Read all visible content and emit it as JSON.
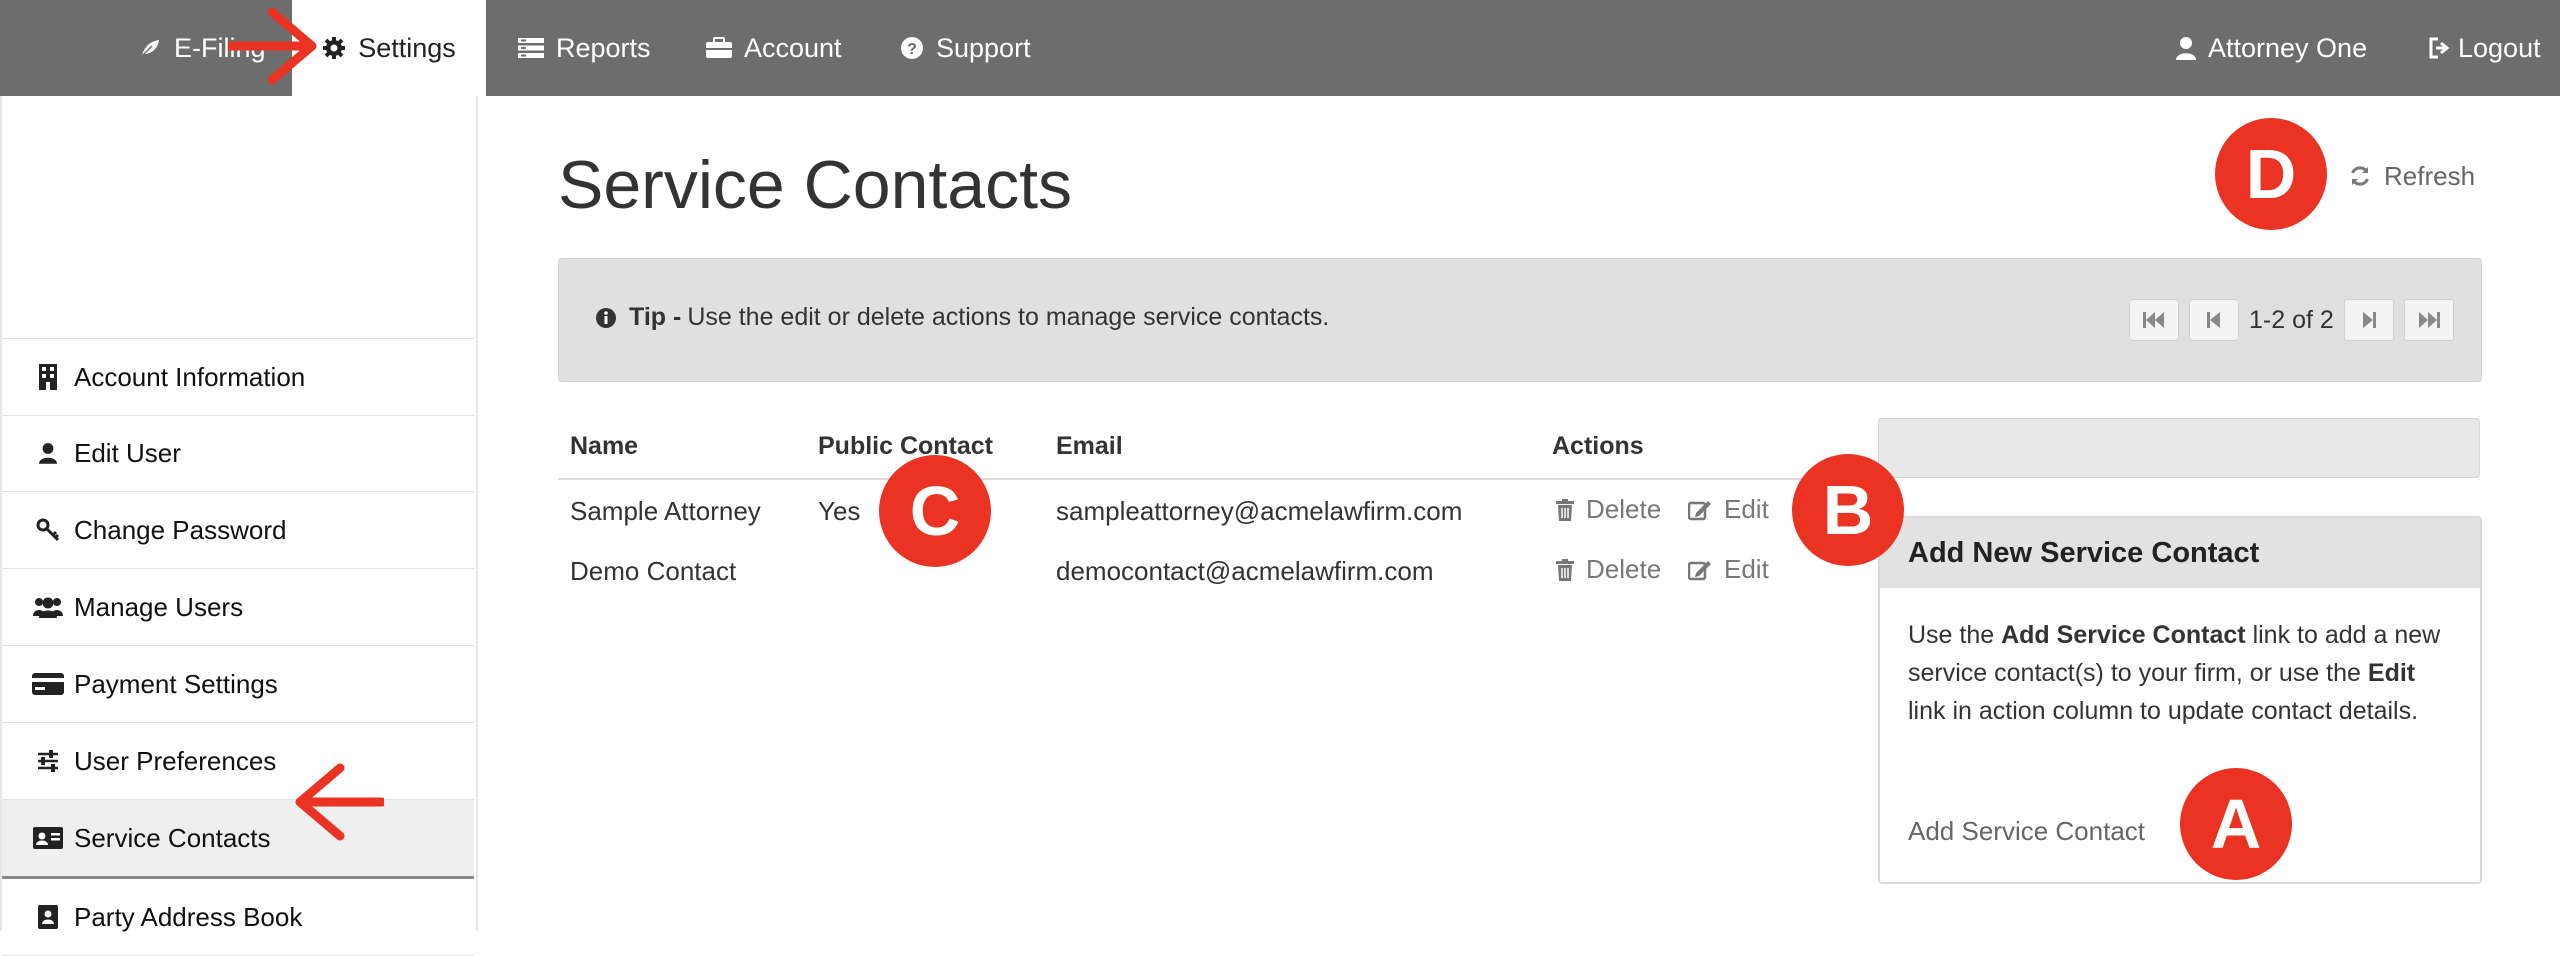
{
  "nav": {
    "efiling": "E-Filing",
    "settings": "Settings",
    "reports": "Reports",
    "account": "Account",
    "support": "Support",
    "user": "Attorney One",
    "logout": "Logout"
  },
  "sidebar": {
    "items": [
      {
        "label": "Account Information",
        "icon": "building-icon"
      },
      {
        "label": "Edit User",
        "icon": "user-icon"
      },
      {
        "label": "Change Password",
        "icon": "key-icon"
      },
      {
        "label": "Manage Users",
        "icon": "users-icon"
      },
      {
        "label": "Payment Settings",
        "icon": "credit-card-icon"
      },
      {
        "label": "User Preferences",
        "icon": "sliders-icon"
      },
      {
        "label": "Service Contacts",
        "icon": "id-card-icon",
        "active": true
      },
      {
        "label": "Party Address Book",
        "icon": "address-book-icon"
      }
    ]
  },
  "page": {
    "title": "Service Contacts",
    "refresh": "Refresh"
  },
  "tip": {
    "label": "Tip -",
    "text": "Use the edit or delete actions to manage service contacts.",
    "page_info": "1-2 of 2"
  },
  "table": {
    "headers": {
      "name": "Name",
      "public": "Public Contact",
      "email": "Email",
      "actions": "Actions"
    },
    "rows": [
      {
        "name": "Sample Attorney",
        "public": "Yes",
        "email": "sampleattorney@acmelawfirm.com",
        "delete": "Delete",
        "edit": "Edit"
      },
      {
        "name": "Demo Contact",
        "public": "",
        "email": "democontact@acmelawfirm.com",
        "delete": "Delete",
        "edit": "Edit"
      }
    ]
  },
  "panel": {
    "title": "Add New Service Contact",
    "t1": "Use the ",
    "b1": "Add Service Contact",
    "t2": " link to add a new service contact(s) to your firm, or use the ",
    "b2": "Edit",
    "t3": " link in action column to update contact details.",
    "link": "Add Service Contact"
  },
  "annotations": {
    "a": "A",
    "b": "B",
    "c": "C",
    "d": "D"
  },
  "colors": {
    "nav_bg": "#6d6d6d",
    "annotation": "#ea3323"
  }
}
